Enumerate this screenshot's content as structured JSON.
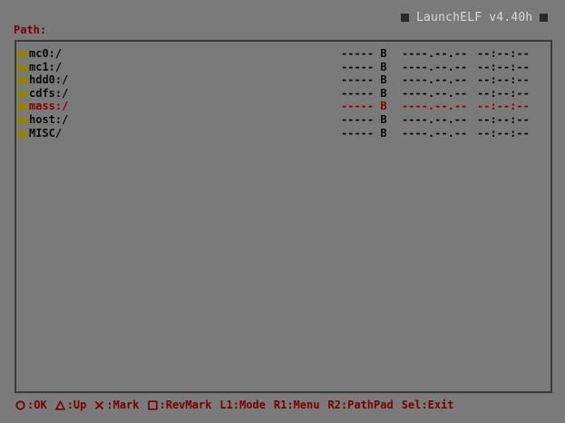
{
  "app": {
    "title": "LaunchELF v4.40h"
  },
  "path": {
    "label": "Path:",
    "value": ""
  },
  "files": [
    {
      "name": "mc0:/",
      "size": "-----",
      "unit": "B",
      "date": "----.--.--",
      "time": "--:--:--",
      "type": "folder",
      "selected": false
    },
    {
      "name": "mc1:/",
      "size": "-----",
      "unit": "B",
      "date": "----.--.--",
      "time": "--:--:--",
      "type": "folder",
      "selected": false
    },
    {
      "name": "hdd0:/",
      "size": "-----",
      "unit": "B",
      "date": "----.--.--",
      "time": "--:--:--",
      "type": "folder",
      "selected": false
    },
    {
      "name": "cdfs:/",
      "size": "-----",
      "unit": "B",
      "date": "----.--.--",
      "time": "--:--:--",
      "type": "folder",
      "selected": false
    },
    {
      "name": "mass:/",
      "size": "-----",
      "unit": "B",
      "date": "----.--.--",
      "time": "--:--:--",
      "type": "folder",
      "selected": true
    },
    {
      "name": "host:/",
      "size": "-----",
      "unit": "B",
      "date": "----.--.--",
      "time": "--:--:--",
      "type": "folder",
      "selected": false
    },
    {
      "name": "MISC/",
      "size": "-----",
      "unit": "B",
      "date": "----.--.--",
      "time": "--:--:--",
      "type": "folder",
      "selected": false
    }
  ],
  "footer": {
    "hints": [
      {
        "icon": "circle-icon",
        "label": ":OK"
      },
      {
        "icon": "triangle-icon",
        "label": ":Up"
      },
      {
        "icon": "cross-icon",
        "label": ":Mark"
      },
      {
        "icon": "square-icon",
        "label": ":RevMark"
      },
      {
        "icon": "",
        "label": "L1:Mode"
      },
      {
        "icon": "",
        "label": "R1:Menu"
      },
      {
        "icon": "",
        "label": "R2:PathPad"
      },
      {
        "icon": "",
        "label": "Sel:Exit"
      }
    ]
  },
  "colors": {
    "background": "#7a7a7a",
    "text": "#0a0a0a",
    "accent": "#7a0000",
    "selected": "#8a0000",
    "folder": "#8f8410",
    "title": "#d8d8d8",
    "frame": "#3c3c3c"
  }
}
